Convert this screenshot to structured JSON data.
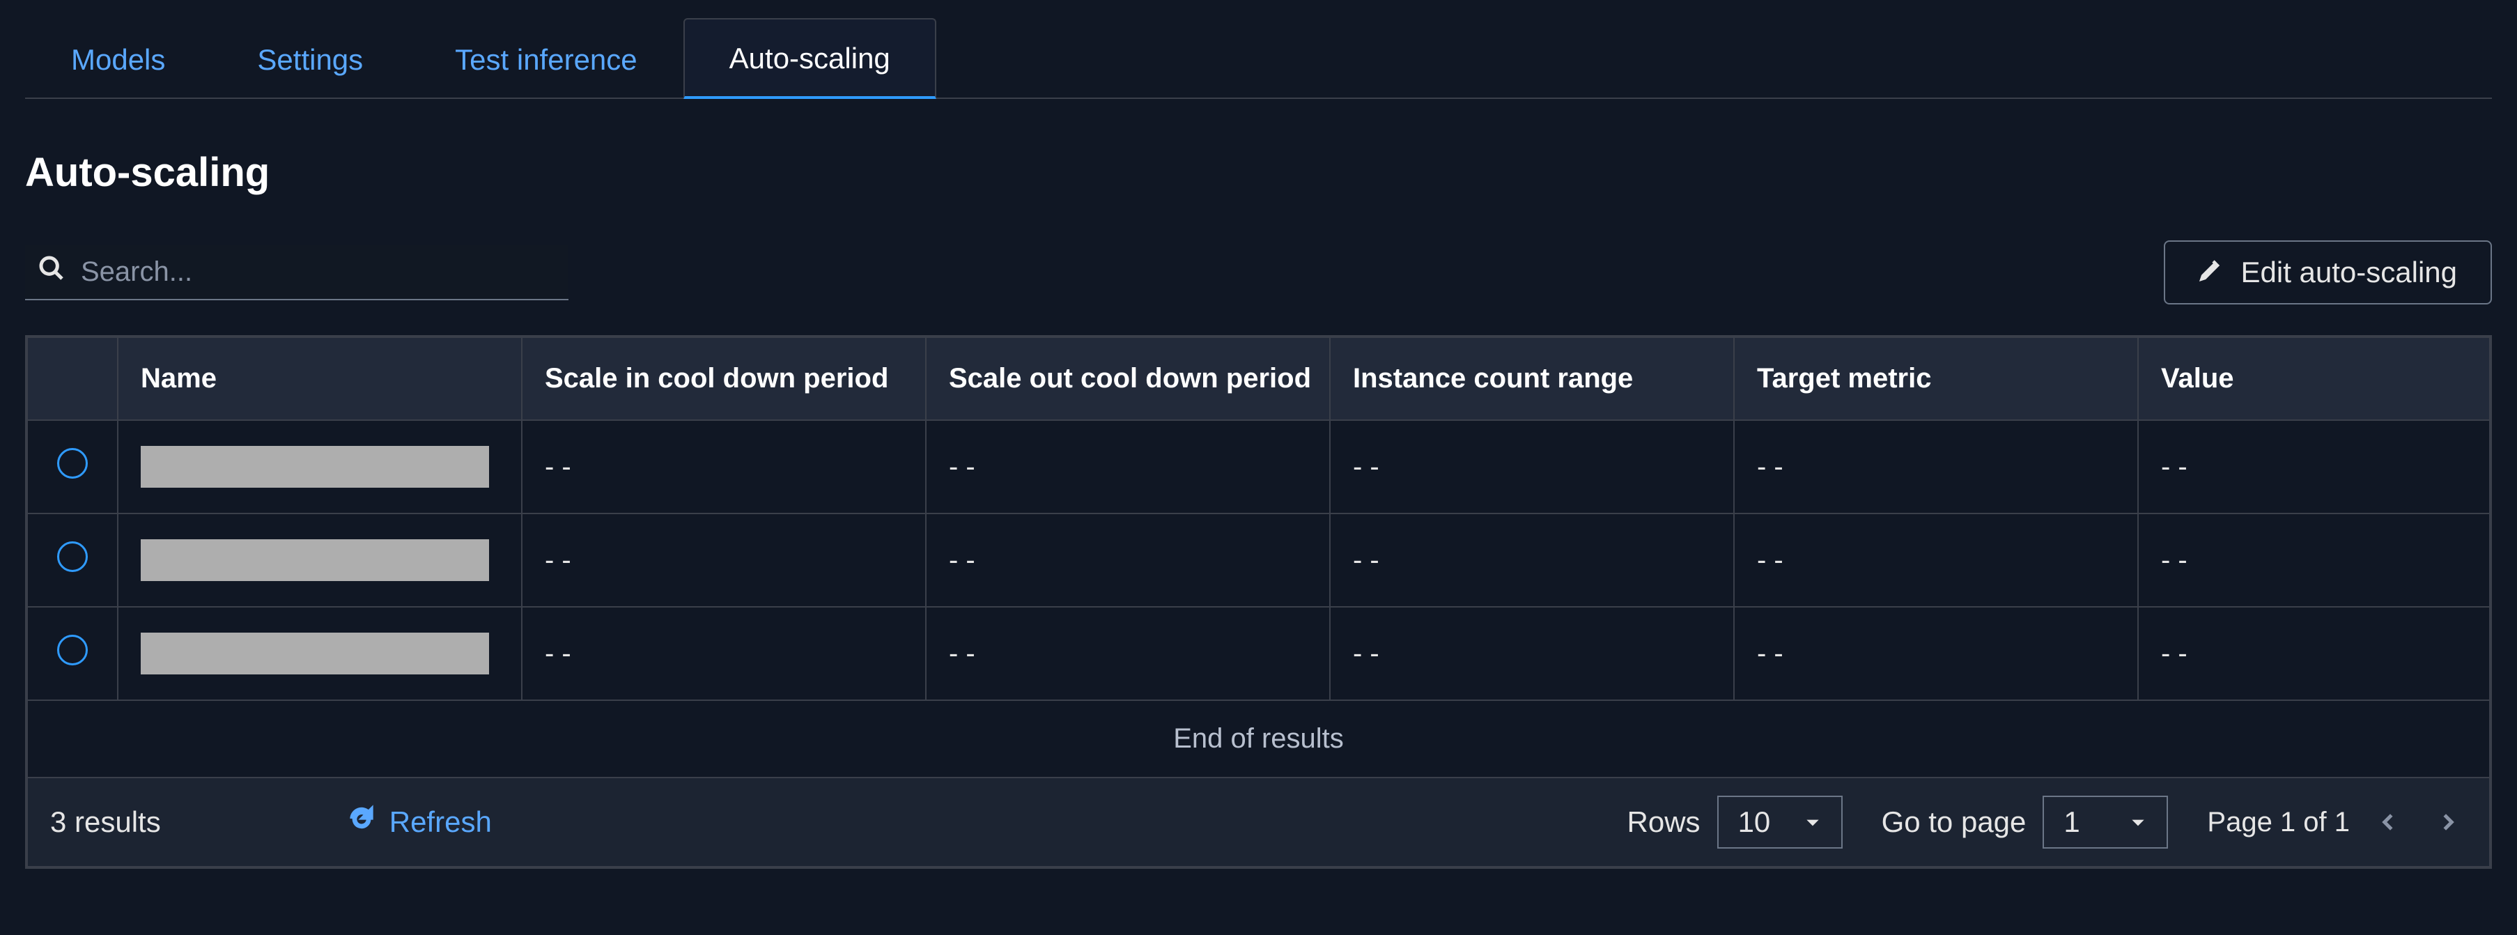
{
  "tabs": [
    {
      "label": "Models",
      "active": false
    },
    {
      "label": "Settings",
      "active": false
    },
    {
      "label": "Test inference",
      "active": false
    },
    {
      "label": "Auto-scaling",
      "active": true
    }
  ],
  "page_title": "Auto-scaling",
  "search": {
    "placeholder": "Search..."
  },
  "edit_button_label": "Edit auto-scaling",
  "table": {
    "columns": [
      "Name",
      "Scale in cool down period",
      "Scale out cool down period",
      "Instance count range",
      "Target metric",
      "Value"
    ],
    "rows": [
      {
        "name": "",
        "scale_in": "- -",
        "scale_out": "- -",
        "instance_range": "- -",
        "target_metric": "- -",
        "value": "- -"
      },
      {
        "name": "",
        "scale_in": "- -",
        "scale_out": "- -",
        "instance_range": "- -",
        "target_metric": "- -",
        "value": "- -"
      },
      {
        "name": "",
        "scale_in": "- -",
        "scale_out": "- -",
        "instance_range": "- -",
        "target_metric": "- -",
        "value": "- -"
      }
    ],
    "end_of_results_label": "End of results"
  },
  "footer": {
    "results_label": "3 results",
    "refresh_label": "Refresh",
    "rows_label": "Rows",
    "rows_value": "10",
    "go_to_page_label": "Go to page",
    "go_to_page_value": "1",
    "page_label": "Page 1 of 1"
  }
}
